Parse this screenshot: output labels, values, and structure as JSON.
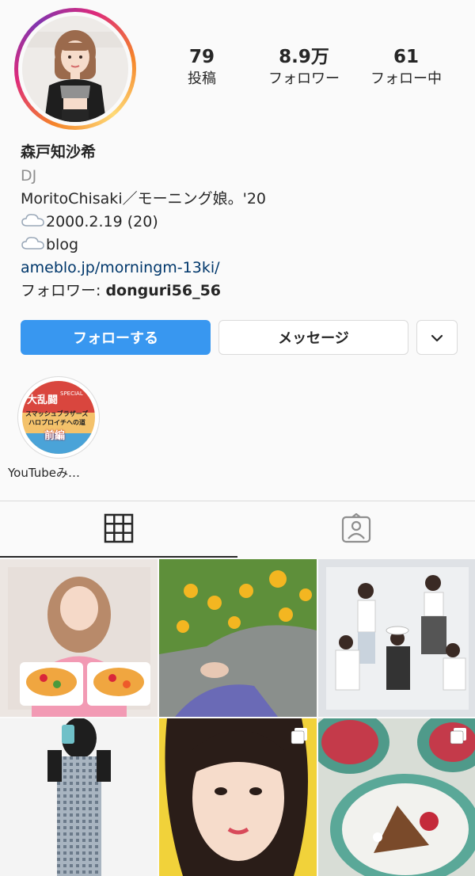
{
  "profile": {
    "name": "森戸知沙希",
    "category": "DJ",
    "bio_line1": "MoritoChisaki／モーニング娘。'20",
    "bio_line2": "2000.2.19 (20)",
    "bio_line3": "blog",
    "link": "ameblo.jp/morningm-13ki/",
    "followed_by_label": "フォロワー: ",
    "followed_by_user": "donguri56_56"
  },
  "stats": {
    "posts": {
      "value": "79",
      "label": "投稿"
    },
    "followers": {
      "value": "8.9万",
      "label": "フォロワー"
    },
    "following": {
      "value": "61",
      "label": "フォロー中"
    }
  },
  "actions": {
    "follow": "フォローする",
    "message": "メッセージ"
  },
  "highlight": {
    "label": "YouTubeみ…",
    "cover_text1": "大乱闘",
    "cover_text2": "スマッシュブラザーズ",
    "cover_text3": "ハロプロイチへの道",
    "cover_text4": "前編",
    "cover_text5": "SPECIAL"
  },
  "icons": {
    "weather": "cloud-icon",
    "grid_tab": "grid-icon",
    "tagged_tab": "tagged-person-icon",
    "more": "chevron-down-icon",
    "multi": "multiple-photos-icon"
  },
  "colors": {
    "follow_button": "#3897f0",
    "link": "#00376b",
    "secondary_text": "#8e8e8e",
    "border": "#dbdbdb"
  }
}
